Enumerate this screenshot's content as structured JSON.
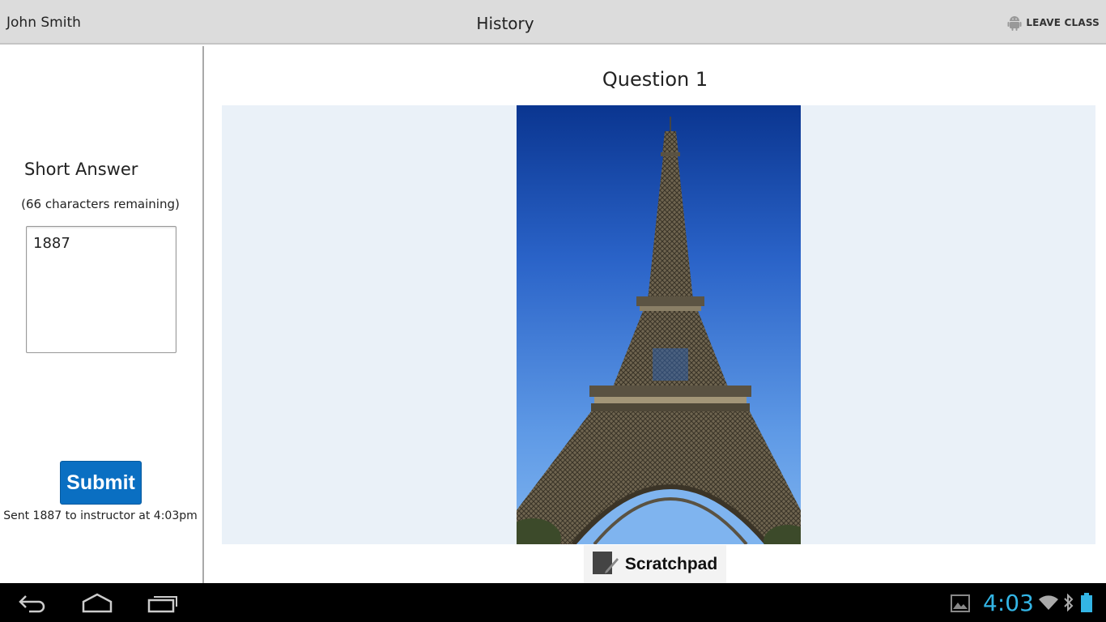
{
  "header": {
    "user_name": "John Smith",
    "class_title": "History",
    "leave_label": "LEAVE CLASS"
  },
  "answer_panel": {
    "title": "Short Answer",
    "chars_remaining": "(66 characters remaining)",
    "answer_value": "1887",
    "submit_label": "Submit",
    "status": "Sent 1887 to instructor at 4:03pm"
  },
  "question": {
    "title": "Question 1",
    "image_subject": "Eiffel Tower photograph",
    "scratchpad_label": "Scratchpad"
  },
  "system_bar": {
    "time": "4:03",
    "icons": [
      "back-icon",
      "home-icon",
      "recent-apps-icon",
      "gallery-icon",
      "wifi-icon",
      "bluetooth-icon",
      "battery-icon"
    ]
  },
  "colors": {
    "accent": "#0a6fc2",
    "clock": "#33b5e5",
    "header_bg": "#dcdcdc",
    "image_bg": "#eaf1f8"
  }
}
